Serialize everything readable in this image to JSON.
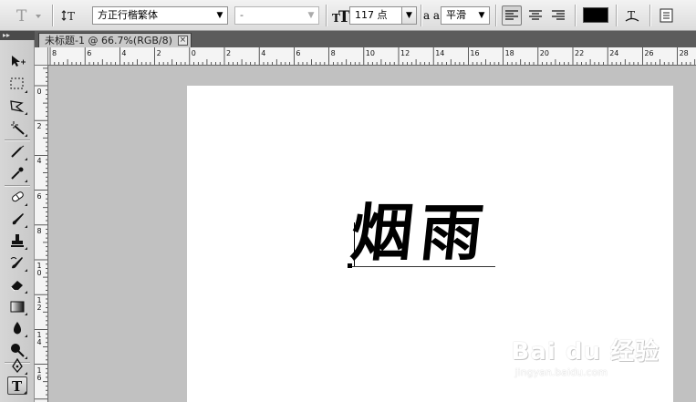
{
  "options_bar": {
    "tool_icon": "type-tool-icon",
    "orientation_icon": "text-orientation-icon",
    "font_family": "方正行楷繁体",
    "font_style": "-",
    "font_size": "117 点",
    "antialias_label": "a a",
    "antialias_value": "平滑",
    "align_buttons": [
      "align-left-icon",
      "align-center-icon",
      "align-right-icon"
    ],
    "text_color": "#000000",
    "warp_icon": "warp-text-icon",
    "panels_icon": "character-panels-icon"
  },
  "tools_panel": {
    "header": "▸▸",
    "tools": [
      "move-tool-icon",
      "marquee-tool-icon",
      "lasso-tool-icon",
      "magic-wand-tool-icon",
      "crop-tool-icon",
      "eyedropper-tool-icon",
      "healing-brush-tool-icon",
      "brush-tool-icon",
      "clone-stamp-tool-icon",
      "history-brush-tool-icon",
      "eraser-tool-icon",
      "gradient-tool-icon",
      "blur-tool-icon",
      "dodge-tool-icon",
      "pen-tool-icon",
      "type-tool-icon"
    ],
    "selected": "type-tool-icon"
  },
  "document": {
    "tab_title": "未标题-1 @ 66.7%(RGB/8)",
    "close_label": "×"
  },
  "rulers": {
    "horizontal_labels": [
      "8",
      "6",
      "4",
      "2",
      "0",
      "2",
      "4",
      "6",
      "8",
      "10",
      "12",
      "14",
      "16",
      "18",
      "20",
      "22",
      "24",
      "26",
      "28"
    ],
    "vertical_labels": [
      "0",
      "2",
      "4",
      "6",
      "8",
      "1 0",
      "1 2",
      "1 4",
      "1 6"
    ]
  },
  "canvas": {
    "text": "烟雨",
    "background": "#ffffff"
  },
  "watermark": {
    "logo": "Bai du 经验",
    "url": "jingyan.baidu.com"
  }
}
